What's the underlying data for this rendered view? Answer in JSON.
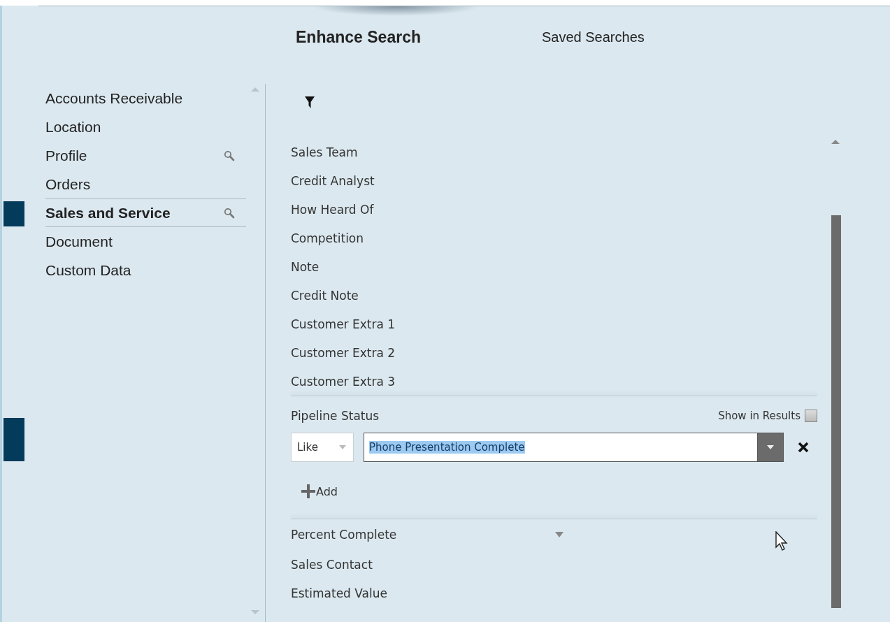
{
  "tabs": [
    {
      "label": "Enhance Search",
      "selected": true
    },
    {
      "label": "Saved Searches",
      "selected": false
    }
  ],
  "sidebar": {
    "items": [
      {
        "label": "Accounts Receivable",
        "selected": false,
        "searchable": false
      },
      {
        "label": "Location",
        "selected": false,
        "searchable": false
      },
      {
        "label": "Profile",
        "selected": false,
        "searchable": true
      },
      {
        "label": "Orders",
        "selected": false,
        "searchable": false
      },
      {
        "label": "Sales and Service",
        "selected": true,
        "searchable": true
      },
      {
        "label": "Document",
        "selected": false,
        "searchable": false
      },
      {
        "label": "Custom Data",
        "selected": false,
        "searchable": false
      }
    ]
  },
  "fields": {
    "before": [
      {
        "label": "Sales Team",
        "kind": "plain"
      },
      {
        "label": "Credit Analyst",
        "kind": "plain"
      },
      {
        "label": "How Heard Of",
        "kind": "plain"
      },
      {
        "label": "Competition",
        "kind": "plain"
      },
      {
        "label": "Note",
        "kind": "plain"
      },
      {
        "label": "Credit Note",
        "kind": "plain"
      },
      {
        "label": "Customer Extra 1",
        "kind": "plain"
      },
      {
        "label": "Customer Extra 2",
        "kind": "plain"
      },
      {
        "label": "Customer Extra 3",
        "kind": "plain"
      }
    ],
    "criterion": {
      "label": "Pipeline Status",
      "show_in_results": {
        "label": "Show in Results",
        "checked": false
      },
      "operator": "Like",
      "value": "Phone Presentation Complete",
      "value_selected": true,
      "add_label": "Add"
    },
    "after": [
      {
        "label": "Percent Complete",
        "kind": "dropdown"
      },
      {
        "label": "Sales Contact",
        "kind": "plain"
      },
      {
        "label": "Estimated Value",
        "kind": "plain"
      }
    ]
  }
}
